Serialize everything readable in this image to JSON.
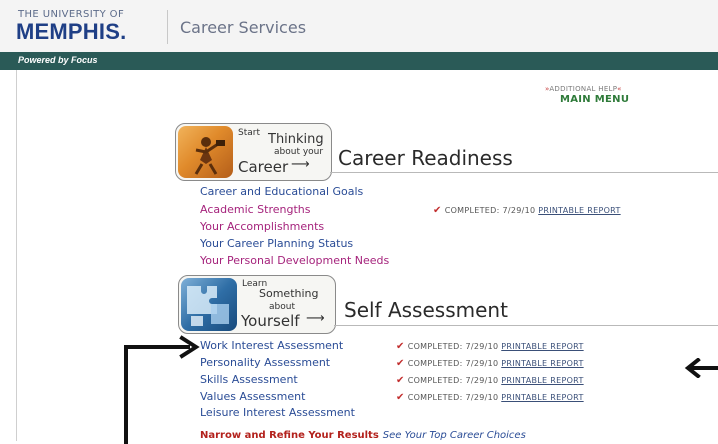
{
  "header": {
    "logo_top": "THE UNIVERSITY OF",
    "logo_main": "MEMPHIS.",
    "site_title": "Career Services",
    "powered_by": "Powered by Focus"
  },
  "nav": {
    "additional_help": "ADDITIONAL HELP",
    "main_menu": "MAIN MENU"
  },
  "career_readiness": {
    "badge_small": "Start",
    "badge_line1": "Thinking",
    "badge_line2": "about your",
    "badge_line3": "Career",
    "title": "Career Readiness",
    "items": [
      {
        "label": "Career and Educational Goals",
        "color": "#2a4c96"
      },
      {
        "label": "Academic Strengths",
        "color": "#a5237c",
        "status": "COMPLETED: 7/29/10",
        "report": "PRINTABLE REPORT"
      },
      {
        "label": "Your Accomplishments",
        "color": "#a5237c"
      },
      {
        "label": "Your Career Planning Status",
        "color": "#2a4c96"
      },
      {
        "label": "Your Personal Development Needs",
        "color": "#a5237c"
      }
    ]
  },
  "self_assessment": {
    "badge_small": "Learn",
    "badge_line1": "Something",
    "badge_line2": "about",
    "badge_line3": "Yourself",
    "title": "Self Assessment",
    "items": [
      {
        "label": "Work Interest Assessment",
        "color": "#2a4c96",
        "status": "COMPLETED: 7/29/10",
        "report": "PRINTABLE REPORT"
      },
      {
        "label": "Personality Assessment",
        "color": "#2a4c96",
        "status": "COMPLETED: 7/29/10",
        "report": "PRINTABLE REPORT"
      },
      {
        "label": "Skills Assessment",
        "color": "#2a4c96",
        "status": "COMPLETED: 7/29/10",
        "report": "PRINTABLE REPORT"
      },
      {
        "label": "Values Assessment",
        "color": "#2a4c96",
        "status": "COMPLETED: 7/29/10",
        "report": "PRINTABLE REPORT"
      },
      {
        "label": "Leisure Interest Assessment",
        "color": "#2a4c96"
      }
    ]
  },
  "footer": {
    "narrow": "Narrow and Refine Your Results",
    "see_top": "See Your Top Career Choices"
  },
  "icons": {
    "check": "checkmark-icon",
    "right_arrow": "arrow-right-icon",
    "left_arrow": "arrow-left-icon"
  }
}
